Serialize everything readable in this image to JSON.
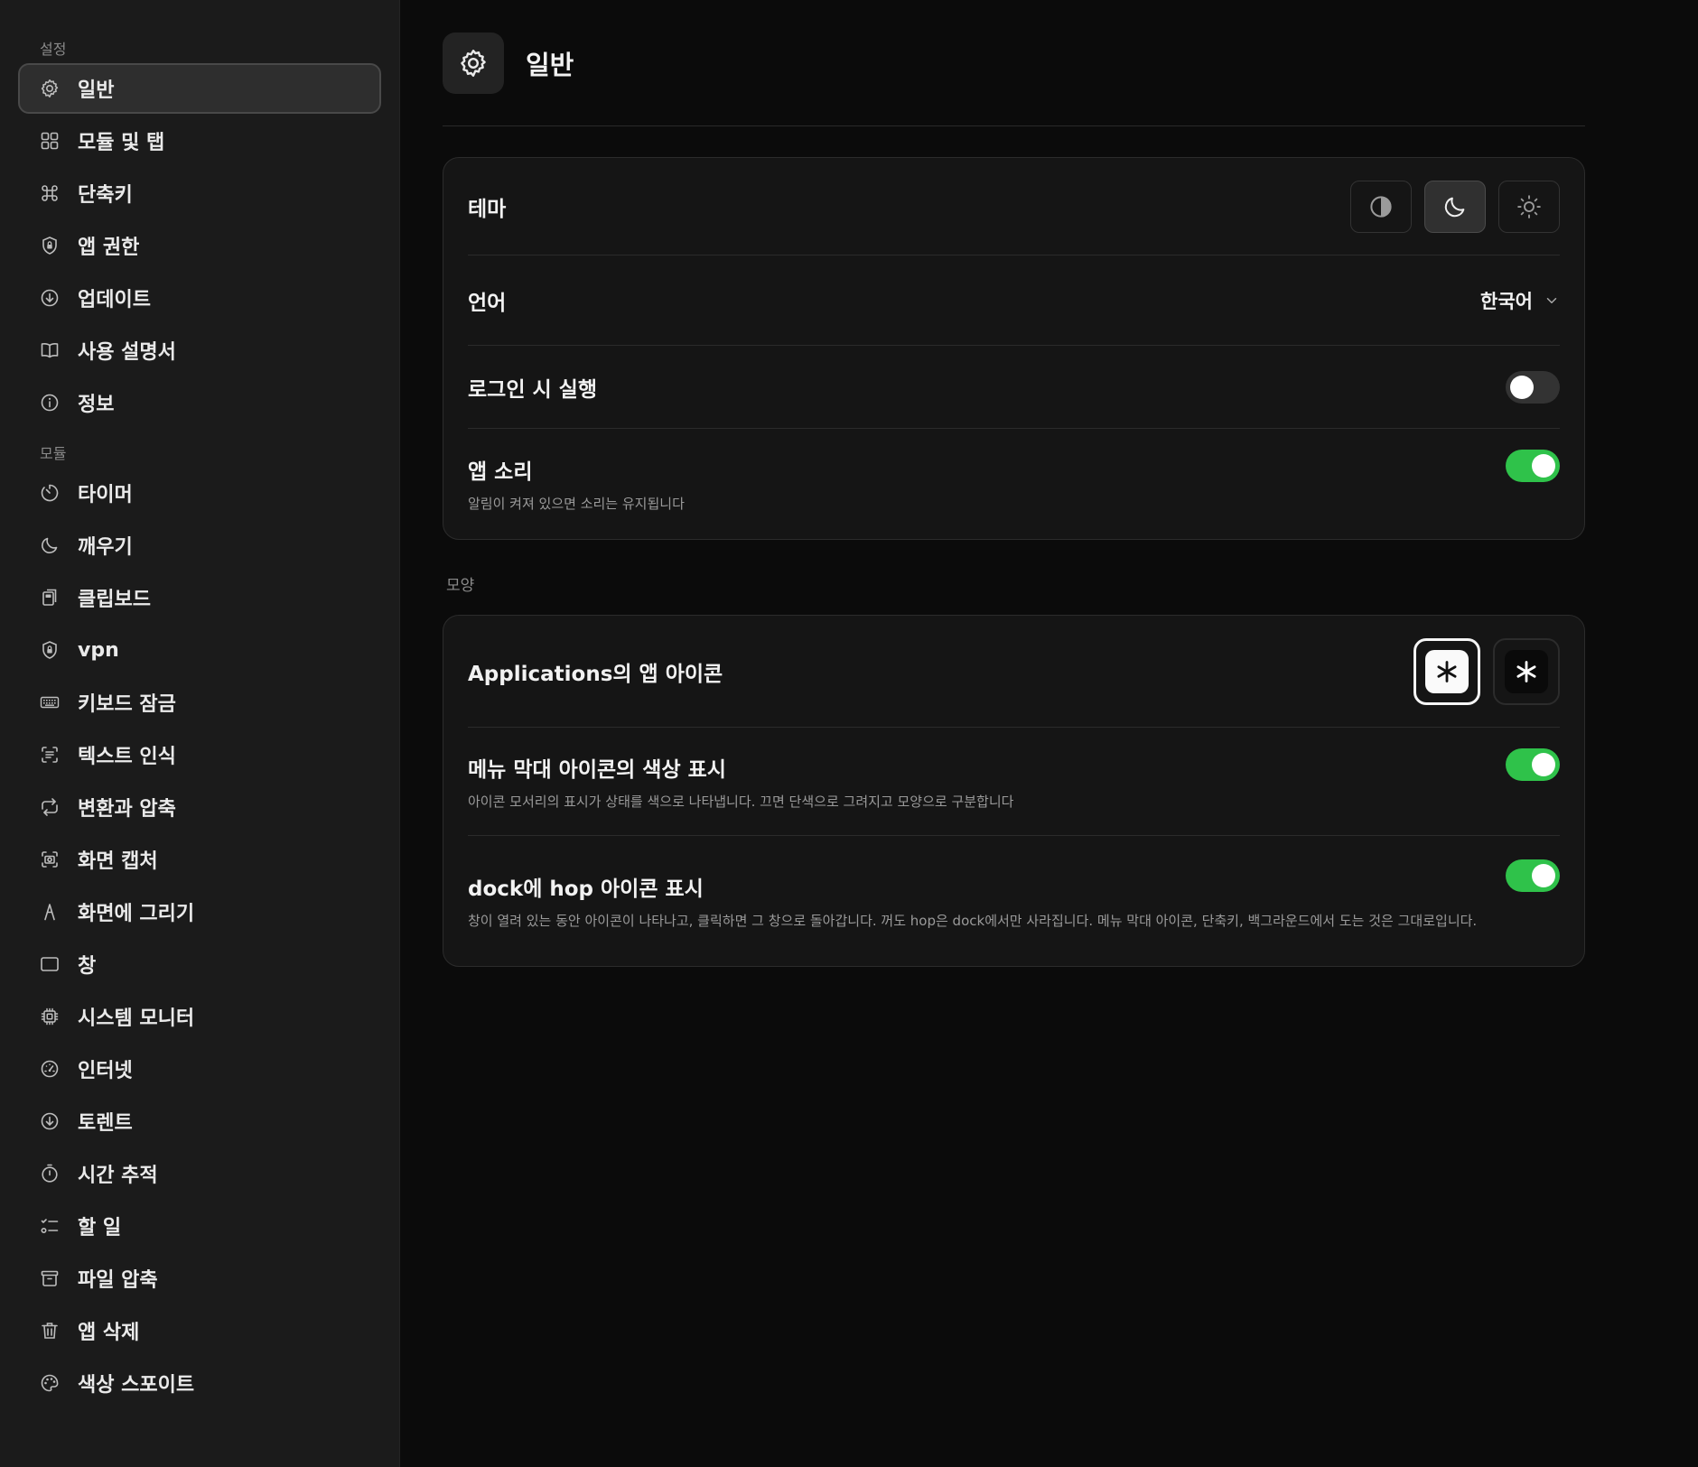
{
  "sidebar": {
    "section1_label": "설정",
    "section2_label": "모듈",
    "settings_items": [
      {
        "label": "일반",
        "icon": "gear-icon"
      },
      {
        "label": "모듈 및 탭",
        "icon": "grid-icon"
      },
      {
        "label": "단축키",
        "icon": "command-icon"
      },
      {
        "label": "앱 권한",
        "icon": "shield-lock-icon"
      },
      {
        "label": "업데이트",
        "icon": "download-circle-icon"
      },
      {
        "label": "사용 설명서",
        "icon": "book-icon"
      },
      {
        "label": "정보",
        "icon": "info-icon"
      }
    ],
    "module_items": [
      {
        "label": "타이머",
        "icon": "timer-icon"
      },
      {
        "label": "깨우기",
        "icon": "moon-icon"
      },
      {
        "label": "클립보드",
        "icon": "clipboard-icon"
      },
      {
        "label": "vpn",
        "icon": "shield-lock-icon"
      },
      {
        "label": "키보드 잠금",
        "icon": "keyboard-icon"
      },
      {
        "label": "텍스트 인식",
        "icon": "text-scan-icon"
      },
      {
        "label": "변환과 압축",
        "icon": "convert-icon"
      },
      {
        "label": "화면 캡처",
        "icon": "camera-icon"
      },
      {
        "label": "화면에 그리기",
        "icon": "pen-icon"
      },
      {
        "label": "창",
        "icon": "window-icon"
      },
      {
        "label": "시스템 모니터",
        "icon": "cpu-icon"
      },
      {
        "label": "인터넷",
        "icon": "gauge-icon"
      },
      {
        "label": "토렌트",
        "icon": "download-circle-icon"
      },
      {
        "label": "시간 추적",
        "icon": "stopwatch-icon"
      },
      {
        "label": "할 일",
        "icon": "checklist-icon"
      },
      {
        "label": "파일 압축",
        "icon": "archive-icon"
      },
      {
        "label": "앱 삭제",
        "icon": "trash-icon"
      },
      {
        "label": "색상 스포이트",
        "icon": "palette-icon"
      }
    ]
  },
  "header": {
    "title": "일반",
    "icon": "gear-icon"
  },
  "general": {
    "theme_label": "테마",
    "theme_options": [
      "system-contrast-icon",
      "moon-icon",
      "sun-icon"
    ],
    "theme_selected": "moon-icon",
    "language_label": "언어",
    "language_value": "한국어",
    "login_label": "로그인 시 실행",
    "login_on": false,
    "sound_label": "앱 소리",
    "sound_sub": "알림이 켜져 있으면 소리는 유지됩니다",
    "sound_on": true
  },
  "appearance": {
    "group_label": "모양",
    "app_icon_label": "Applications의 앱 아이콘",
    "app_icon_options": [
      "light",
      "dark"
    ],
    "app_icon_selected": "light",
    "menu_color_label": "메뉴 막대 아이콘의 색상 표시",
    "menu_color_sub": "아이콘 모서리의 표시가 상태를 색으로 나타냅니다. 끄면 단색으로 그려지고 모양으로 구분합니다",
    "menu_color_on": true,
    "dock_label": "dock에 hop 아이콘 표시",
    "dock_sub": "창이 열려 있는 동안 아이콘이 나타나고, 클릭하면 그 창으로 돌아갑니다. 꺼도 hop은 dock에서만 사라집니다. 메뉴 막대 아이콘, 단축키, 백그라운드에서 도는 것은 그대로입니다.",
    "dock_on": true
  },
  "colors": {
    "toggle_on": "#2fc24a",
    "toggle_off": "#333333",
    "background": "#0b0b0b",
    "sidebar": "#1b1b1b"
  }
}
